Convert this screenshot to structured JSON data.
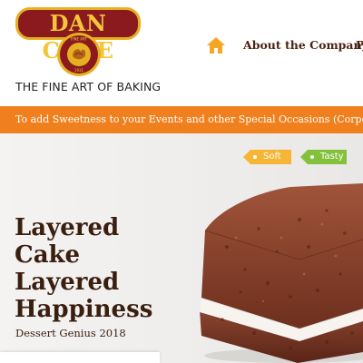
{
  "brand": {
    "name": "DAN CAKE",
    "seal_text": "THE FINE ART OF BAKING · SINCE 1931",
    "tagline": "THE FINE ART OF BAKING"
  },
  "nav": {
    "home_icon": "home-icon",
    "items": [
      "About the Company",
      "P"
    ]
  },
  "promo": {
    "text": "To add Sweetness to your Events and other Special Occasions (Corporate Sales/Bu"
  },
  "hero": {
    "tags": [
      "Soft",
      "Tasty"
    ],
    "title_lines": [
      "Layered",
      "Cake",
      "Layered",
      "Happiness"
    ],
    "subtitle": "Dessert Genius 2018"
  },
  "colors": {
    "brand_red": "#8a1a1e",
    "brand_gold": "#e7b020",
    "promo_orange": "#f0801e",
    "home_icon": "#f5a623",
    "tag_soft": "#f6b535",
    "tag_tasty": "#84c13b",
    "text_brown": "#3a1e10"
  }
}
